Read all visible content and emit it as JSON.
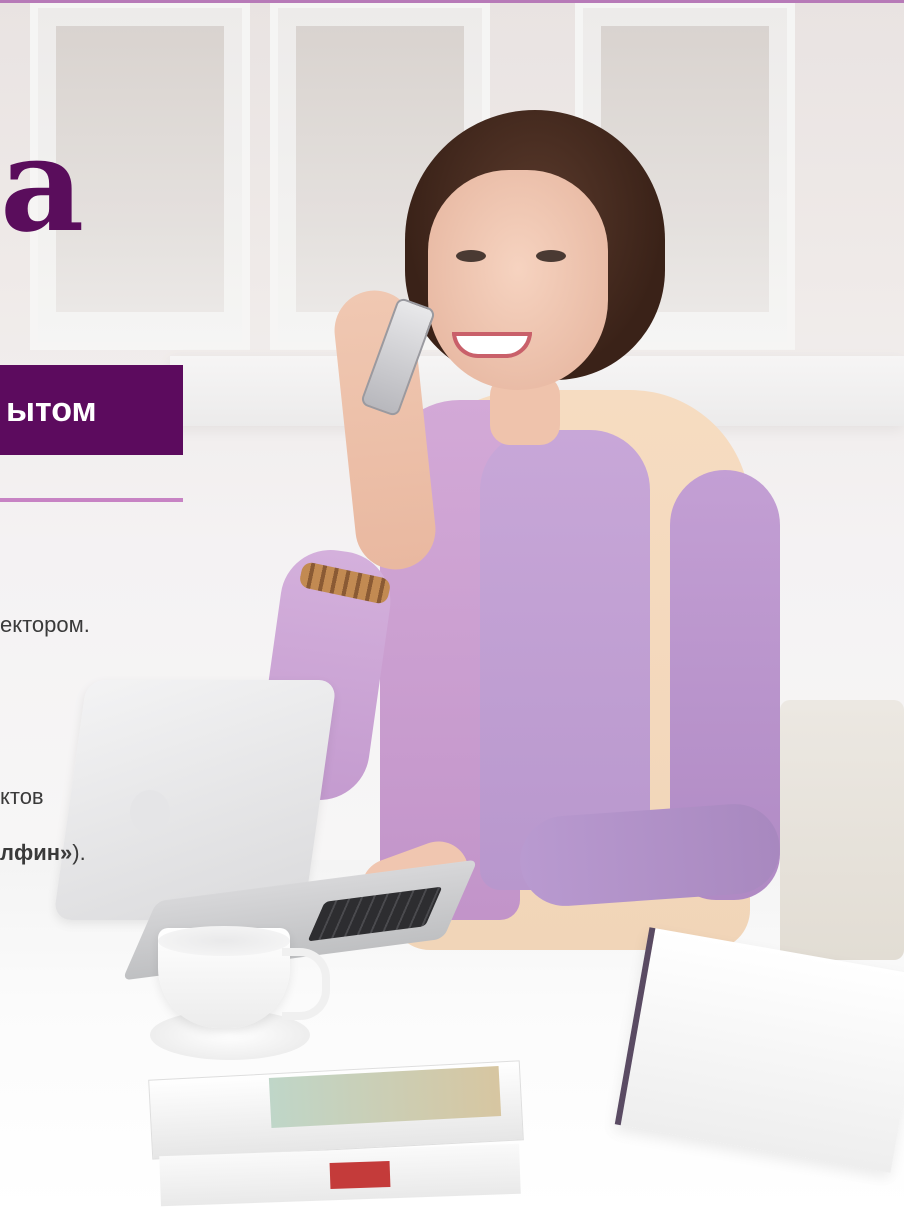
{
  "hero": {
    "big_letter": "a",
    "banner": "ытом"
  },
  "body_text": {
    "line1": "ектором.",
    "line2": "ктов",
    "line3_bold": "лфин»",
    "line3_tail": ")."
  },
  "colors": {
    "accent": "#5c0b5e",
    "accent_light": "#c783c4"
  }
}
